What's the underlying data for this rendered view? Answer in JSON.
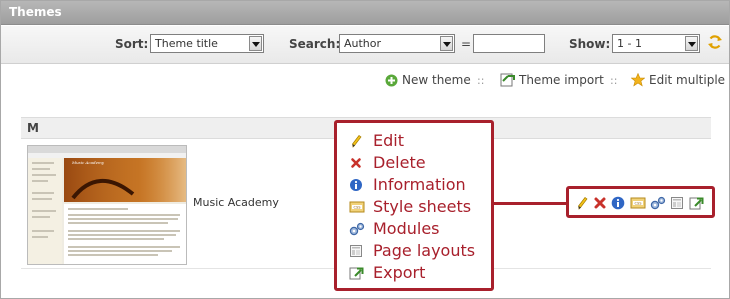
{
  "window": {
    "title": "Themes"
  },
  "filters": {
    "sort_label": "Sort:",
    "sort_value": "Theme title",
    "search_label": "Search:",
    "search_field": "Author",
    "search_operator": "=",
    "search_value": "",
    "show_label": "Show:",
    "show_value": "1 - 1"
  },
  "actions": {
    "new_theme": "New theme",
    "theme_import": "Theme import",
    "edit_multiple": "Edit multiple",
    "separator": "::"
  },
  "group": {
    "letter": "M"
  },
  "theme": {
    "name": "Music Academy",
    "thumb_title": "Music Academy"
  },
  "row_icons": [
    "pencil-icon",
    "delete-icon",
    "info-icon",
    "stylesheet-icon",
    "modules-icon",
    "page-layouts-icon",
    "export-icon"
  ],
  "callout": {
    "items": [
      {
        "label": "Edit",
        "icon": "pencil-icon"
      },
      {
        "label": "Delete",
        "icon": "delete-icon"
      },
      {
        "label": "Information",
        "icon": "info-icon"
      },
      {
        "label": "Style sheets",
        "icon": "stylesheet-icon"
      },
      {
        "label": "Modules",
        "icon": "modules-icon"
      },
      {
        "label": "Page layouts",
        "icon": "page-layouts-icon"
      },
      {
        "label": "Export",
        "icon": "export-icon"
      }
    ]
  },
  "colors": {
    "highlight": "#a8202c",
    "callout_text": "#a8202c"
  }
}
